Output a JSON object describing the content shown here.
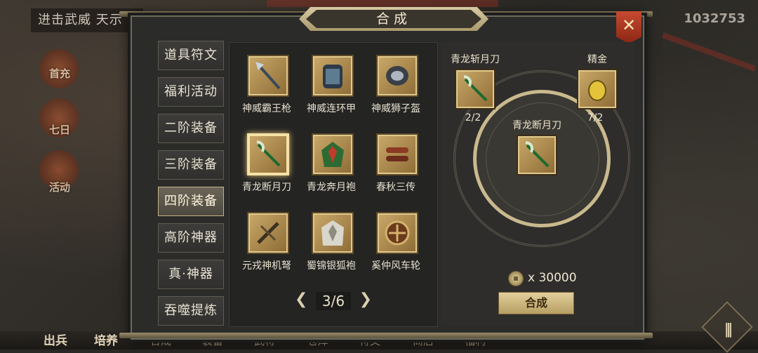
{
  "background": {
    "top_left_text": "进击武威 天示",
    "gold_amount": "1032753",
    "side_icons": [
      {
        "label": "首充",
        "icon": "gift-icon"
      },
      {
        "label": "七日",
        "icon": "calendar-icon"
      },
      {
        "label": "活动",
        "icon": "lantern-icon"
      }
    ],
    "bottom_nav": [
      "出兵",
      "培养",
      "合成",
      "装备",
      "武将",
      "仓库",
      "符文",
      "商店",
      "福利"
    ]
  },
  "dialog": {
    "title": "合成",
    "close_icon": "close-icon"
  },
  "categories": [
    {
      "label": "道具符文",
      "active": false
    },
    {
      "label": "福利活动",
      "active": false
    },
    {
      "label": "二阶装备",
      "active": false
    },
    {
      "label": "三阶装备",
      "active": false
    },
    {
      "label": "四阶装备",
      "active": true
    },
    {
      "label": "高阶神器",
      "active": false
    },
    {
      "label": "真·神器",
      "active": false
    },
    {
      "label": "吞噬提炼",
      "active": false
    }
  ],
  "items": [
    {
      "name": "神威霸王枪",
      "icon": "spear-icon",
      "selected": false
    },
    {
      "name": "神威连环甲",
      "icon": "armor-icon",
      "selected": false
    },
    {
      "name": "神威狮子盔",
      "icon": "helmet-icon",
      "selected": false
    },
    {
      "name": "青龙断月刀",
      "icon": "glaive-icon",
      "selected": true
    },
    {
      "name": "青龙奔月袍",
      "icon": "robe-icon",
      "selected": false
    },
    {
      "name": "春秋三传",
      "icon": "scroll-icon",
      "selected": false
    },
    {
      "name": "元戎神机弩",
      "icon": "crossbow-icon",
      "selected": false
    },
    {
      "name": "蜀锦银狐袍",
      "icon": "fur-robe-icon",
      "selected": false
    },
    {
      "name": "奚仲风车轮",
      "icon": "wheel-icon",
      "selected": false
    }
  ],
  "pager": {
    "prev": "❮",
    "next": "❯",
    "current": "3/6"
  },
  "recipe": {
    "material_1": {
      "name": "青龙斩月刀",
      "count": "2/2",
      "icon": "glaive-icon"
    },
    "material_2": {
      "name": "精金",
      "count": "7/2",
      "icon": "gold-nugget-icon"
    },
    "result": {
      "name": "青龙断月刀",
      "icon": "glaive-icon"
    },
    "cost": "x 30000",
    "button_label": "合成"
  },
  "colors": {
    "accent_gold": "#c9b98e",
    "close_red": "#c74a30",
    "item_bg": "#caa96a"
  }
}
